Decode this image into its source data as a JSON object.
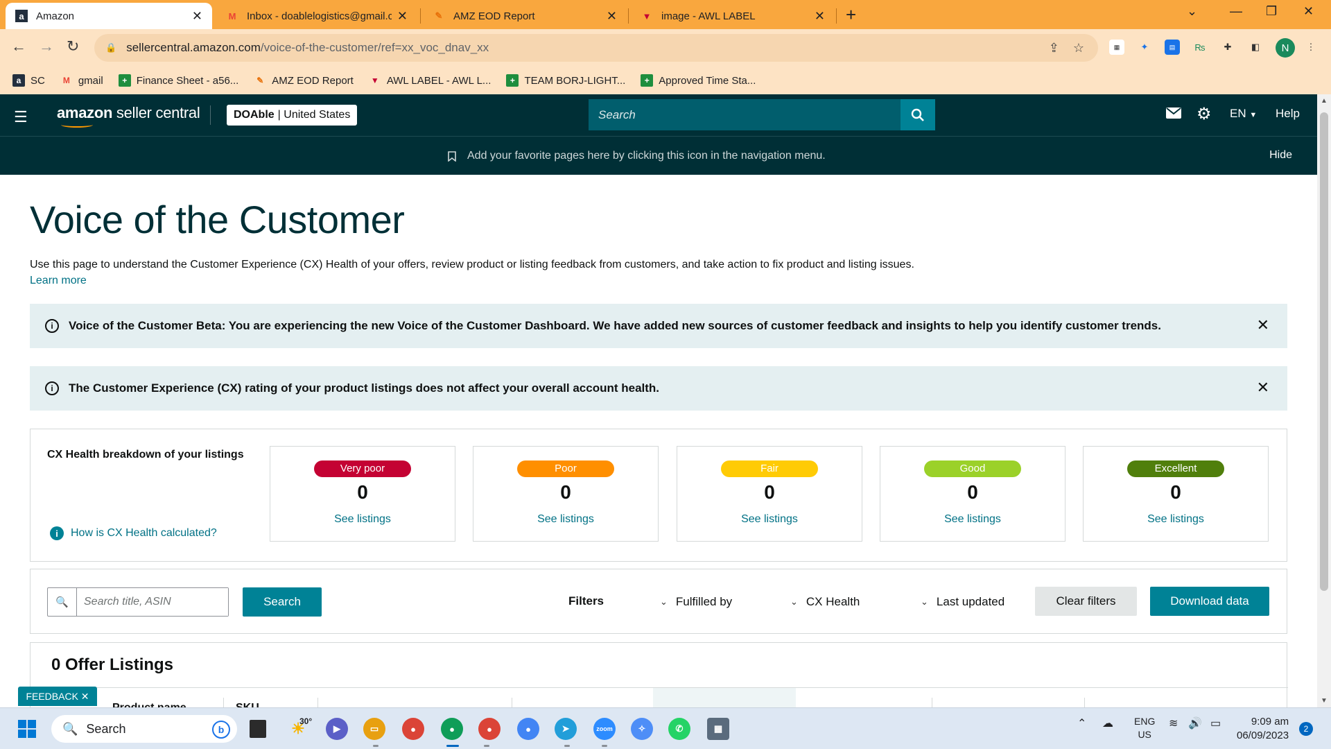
{
  "browser": {
    "tabs": [
      {
        "title": "Amazon",
        "favicon": "amazon-a",
        "active": true
      },
      {
        "title": "Inbox - doablelogistics@gmail.co",
        "favicon": "gmail-m",
        "active": false
      },
      {
        "title": "AMZ EOD Report",
        "favicon": "sheets-pen",
        "active": false
      },
      {
        "title": "image - AWL LABEL",
        "favicon": "awl-v",
        "active": false
      }
    ],
    "url_host": "sellercentral.amazon.com",
    "url_path": "/voice-of-the-customer/ref=xx_voc_dnav_xx",
    "profile_initial": "N",
    "bookmarks": [
      "SC",
      "gmail",
      "Finance Sheet - a56...",
      "AMZ EOD Report",
      "AWL LABEL - AWL L...",
      "TEAM BORJ-LIGHT...",
      "Approved Time Sta..."
    ]
  },
  "header": {
    "logo_bold": "amazon",
    "logo_rest": " seller central",
    "store_name": "DOAble",
    "store_region": " | United States",
    "search_placeholder": "Search",
    "language": "EN",
    "help": "Help",
    "favorites_msg": "Add your favorite pages here by clicking this icon in the navigation menu.",
    "hide": "Hide"
  },
  "page": {
    "title": "Voice of the Customer",
    "description": "Use this page to understand the Customer Experience (CX) Health of your offers, review product or listing feedback from customers, and take action to fix product and listing issues.",
    "learn_more": "Learn more",
    "alert_beta": "Voice of the Customer Beta: You are experiencing the new Voice of the Customer Dashboard. We have added new sources of customer feedback and insights to help you identify customer trends.",
    "alert_cx": "The Customer Experience (CX) rating of your product listings does not affect your overall account health."
  },
  "cx": {
    "title": "CX Health breakdown of your listings",
    "help_link": "How is CX Health calculated?",
    "see_listings": "See listings",
    "cards": [
      {
        "label": "Very poor",
        "count": "0",
        "color": "#c40233",
        "text_color": "#ffffff"
      },
      {
        "label": "Poor",
        "count": "0",
        "color": "#ff8f00",
        "text_color": "#ffffff"
      },
      {
        "label": "Fair",
        "count": "0",
        "color": "#ffcb05",
        "text_color": "#ffffff"
      },
      {
        "label": "Good",
        "count": "0",
        "color": "#9bd129",
        "text_color": "#ffffff"
      },
      {
        "label": "Excellent",
        "count": "0",
        "color": "#507f0c",
        "text_color": "#ffffff"
      }
    ]
  },
  "filters": {
    "search_placeholder": "Search title, ASIN",
    "search_button": "Search",
    "label": "Filters",
    "fulfilled_by": "Fulfilled by",
    "cx_health": "CX Health",
    "last_updated": "Last updated",
    "clear": "Clear filters",
    "download": "Download data"
  },
  "offers": {
    "title": "0 Offer Listings",
    "col_product": "Product name",
    "col_sku": "SKU"
  },
  "feedback": "FEEDBACK",
  "taskbar": {
    "search": "Search",
    "weather": "30°",
    "lang_top": "ENG",
    "lang_bottom": "US",
    "time": "9:09 am",
    "date": "06/09/2023",
    "notifications": "2"
  }
}
